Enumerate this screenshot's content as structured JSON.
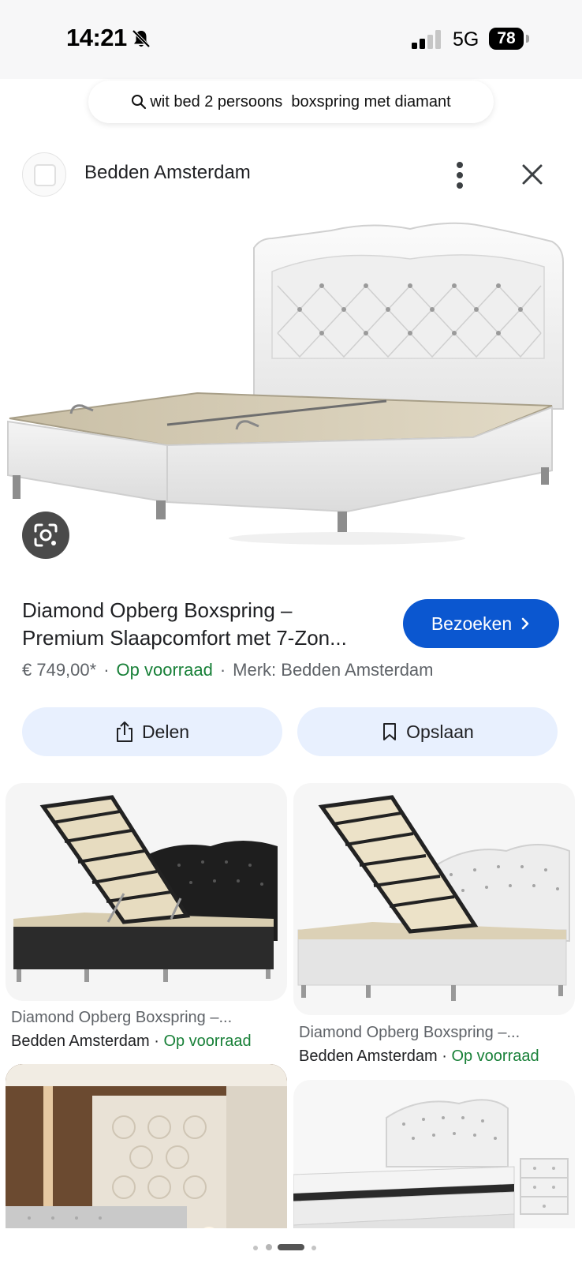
{
  "status_bar": {
    "time": "14:21",
    "network": "5G",
    "battery": "78"
  },
  "search": {
    "query": "wit bed 2 persoons  boxspring met diamant"
  },
  "source": {
    "name": "Bedden Amsterdam"
  },
  "product": {
    "title_line1": "Diamond Opberg Boxspring –",
    "title_line2": "Premium Slaapcomfort met 7-Zon...",
    "visit_label": "Bezoeken",
    "price": "€ 749,00*",
    "stock": "Op voorraad",
    "brand": "Merk: Bedden Amsterdam",
    "separator": "·"
  },
  "actions": {
    "share_label": "Delen",
    "save_label": "Opslaan"
  },
  "related": [
    {
      "title": "Diamond Opberg Boxspring –...",
      "source": "Bedden Amsterdam",
      "separator": " · ",
      "stock": "Op voorraad"
    },
    {
      "title": "Diamond Opberg Boxspring –...",
      "source": "Bedden Amsterdam",
      "separator": " · ",
      "stock": "Op voorraad"
    }
  ],
  "colors": {
    "accent": "#0b57d0",
    "in_stock": "#188038",
    "action_bg": "#e8f0fe"
  }
}
